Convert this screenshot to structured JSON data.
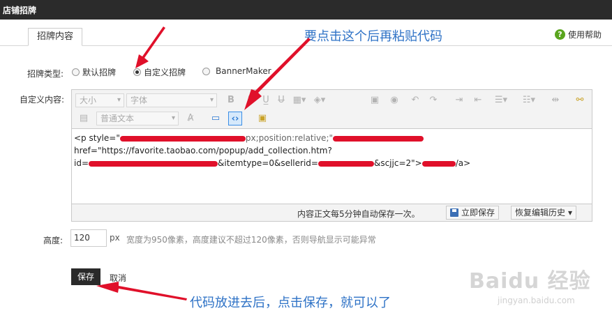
{
  "window": {
    "title": "店铺招牌"
  },
  "tabs": [
    {
      "label": "招牌内容",
      "active": true
    }
  ],
  "help": {
    "label": "使用帮助"
  },
  "annotations": {
    "top": "要点击这个后再粘贴代码",
    "bottom": "代码放进去后，点击保存，就可以了"
  },
  "form": {
    "type_label": "招牌类型:",
    "options": [
      {
        "label": "默认招牌",
        "checked": false
      },
      {
        "label": "自定义招牌",
        "checked": true
      },
      {
        "label": "BannerMaker",
        "checked": false
      }
    ],
    "content_label": "自定义内容:",
    "height_label": "高度:",
    "height_value": "120",
    "height_unit": "px",
    "height_hint": "宽度为950像素，高度建议不超过120像素，否则导航显示可能异常"
  },
  "editor": {
    "size_select": "大小",
    "font_select": "字体",
    "paragraph_select": "普通文本",
    "content_line1_a": "<p style=\"",
    "content_line1_b": "px;position:relative;\"",
    "content_line1_c": "href=\"https://favorite.taobao.com/popup/add_collection.htm?",
    "content_line2_a": "id=",
    "content_line2_b": "&itemtype=0&sellerid=",
    "content_line2_c": "&scjjc=2\">",
    "content_line2_d": "/a>",
    "autosave_text": "内容正文每5分钟自动保存一次。",
    "save_now": "立即保存",
    "restore_history": "恢复编辑历史"
  },
  "buttons": {
    "save": "保存",
    "cancel": "取消"
  },
  "watermark": {
    "main": "Baidu 经验",
    "sub": "jingyan.baidu.com"
  },
  "colors": {
    "annotation": "#2e72c6",
    "arrow": "#e0102a",
    "titlebar": "#2b2b2b"
  }
}
